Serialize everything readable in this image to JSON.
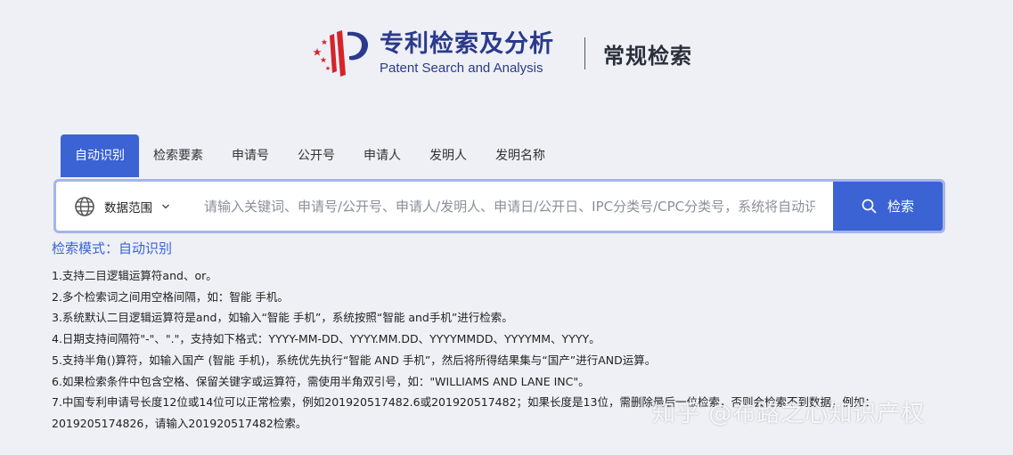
{
  "header": {
    "logo_cn": "专利检索及分析",
    "logo_en": "Patent Search and Analysis",
    "page_title": "常规检索"
  },
  "tabs": [
    {
      "label": "自动识别",
      "active": true
    },
    {
      "label": "检索要素",
      "active": false
    },
    {
      "label": "申请号",
      "active": false
    },
    {
      "label": "公开号",
      "active": false
    },
    {
      "label": "申请人",
      "active": false
    },
    {
      "label": "发明人",
      "active": false
    },
    {
      "label": "发明名称",
      "active": false
    }
  ],
  "search": {
    "scope_label": "数据范围",
    "placeholder": "请输入关键词、申请号/公开号、申请人/发明人、申请日/公开日、IPC分类号/CPC分类号，系统将自动识别检索类型",
    "button_label": "检索"
  },
  "mode": {
    "text": "检索模式：自动识别"
  },
  "tips": [
    "1.支持二目逻辑运算符and、or。",
    "2.多个检索词之间用空格间隔，如：智能 手机。",
    "3.系统默认二目逻辑运算符是and，如输入“智能 手机”，系统按照“智能 and手机”进行检索。",
    "4.日期支持间隔符\"-\"、\".\"，支持如下格式：YYYY-MM-DD、YYYY.MM.DD、YYYYMMDD、YYYYMM、YYYY。",
    "5.支持半角()算符，如输入国产 (智能 手机)，系统优先执行“智能 AND 手机”，然后将所得结果集与“国产”进行AND运算。",
    "6.如果检索条件中包含空格、保留关键字或运算符，需使用半角双引号，如：\"WILLIAMS AND LANE INC\"。",
    "7.中国专利申请号长度12位或14位可以正常检索，例如201920517482.6或201920517482；如果长度是13位，需删除最后一位检索，否则会检索不到数据，例如：",
    "2019205174826，请输入201920517482检索。"
  ],
  "watermark": "知乎 @布路之心知识产权",
  "colors": {
    "accent": "#3b63d4",
    "logo_blue": "#2b3a8c",
    "logo_red": "#d4252b",
    "background": "#eef0f6"
  },
  "icons": {
    "scope": "globe-icon",
    "scope_toggle": "chevron-down-icon",
    "search": "search-icon"
  }
}
